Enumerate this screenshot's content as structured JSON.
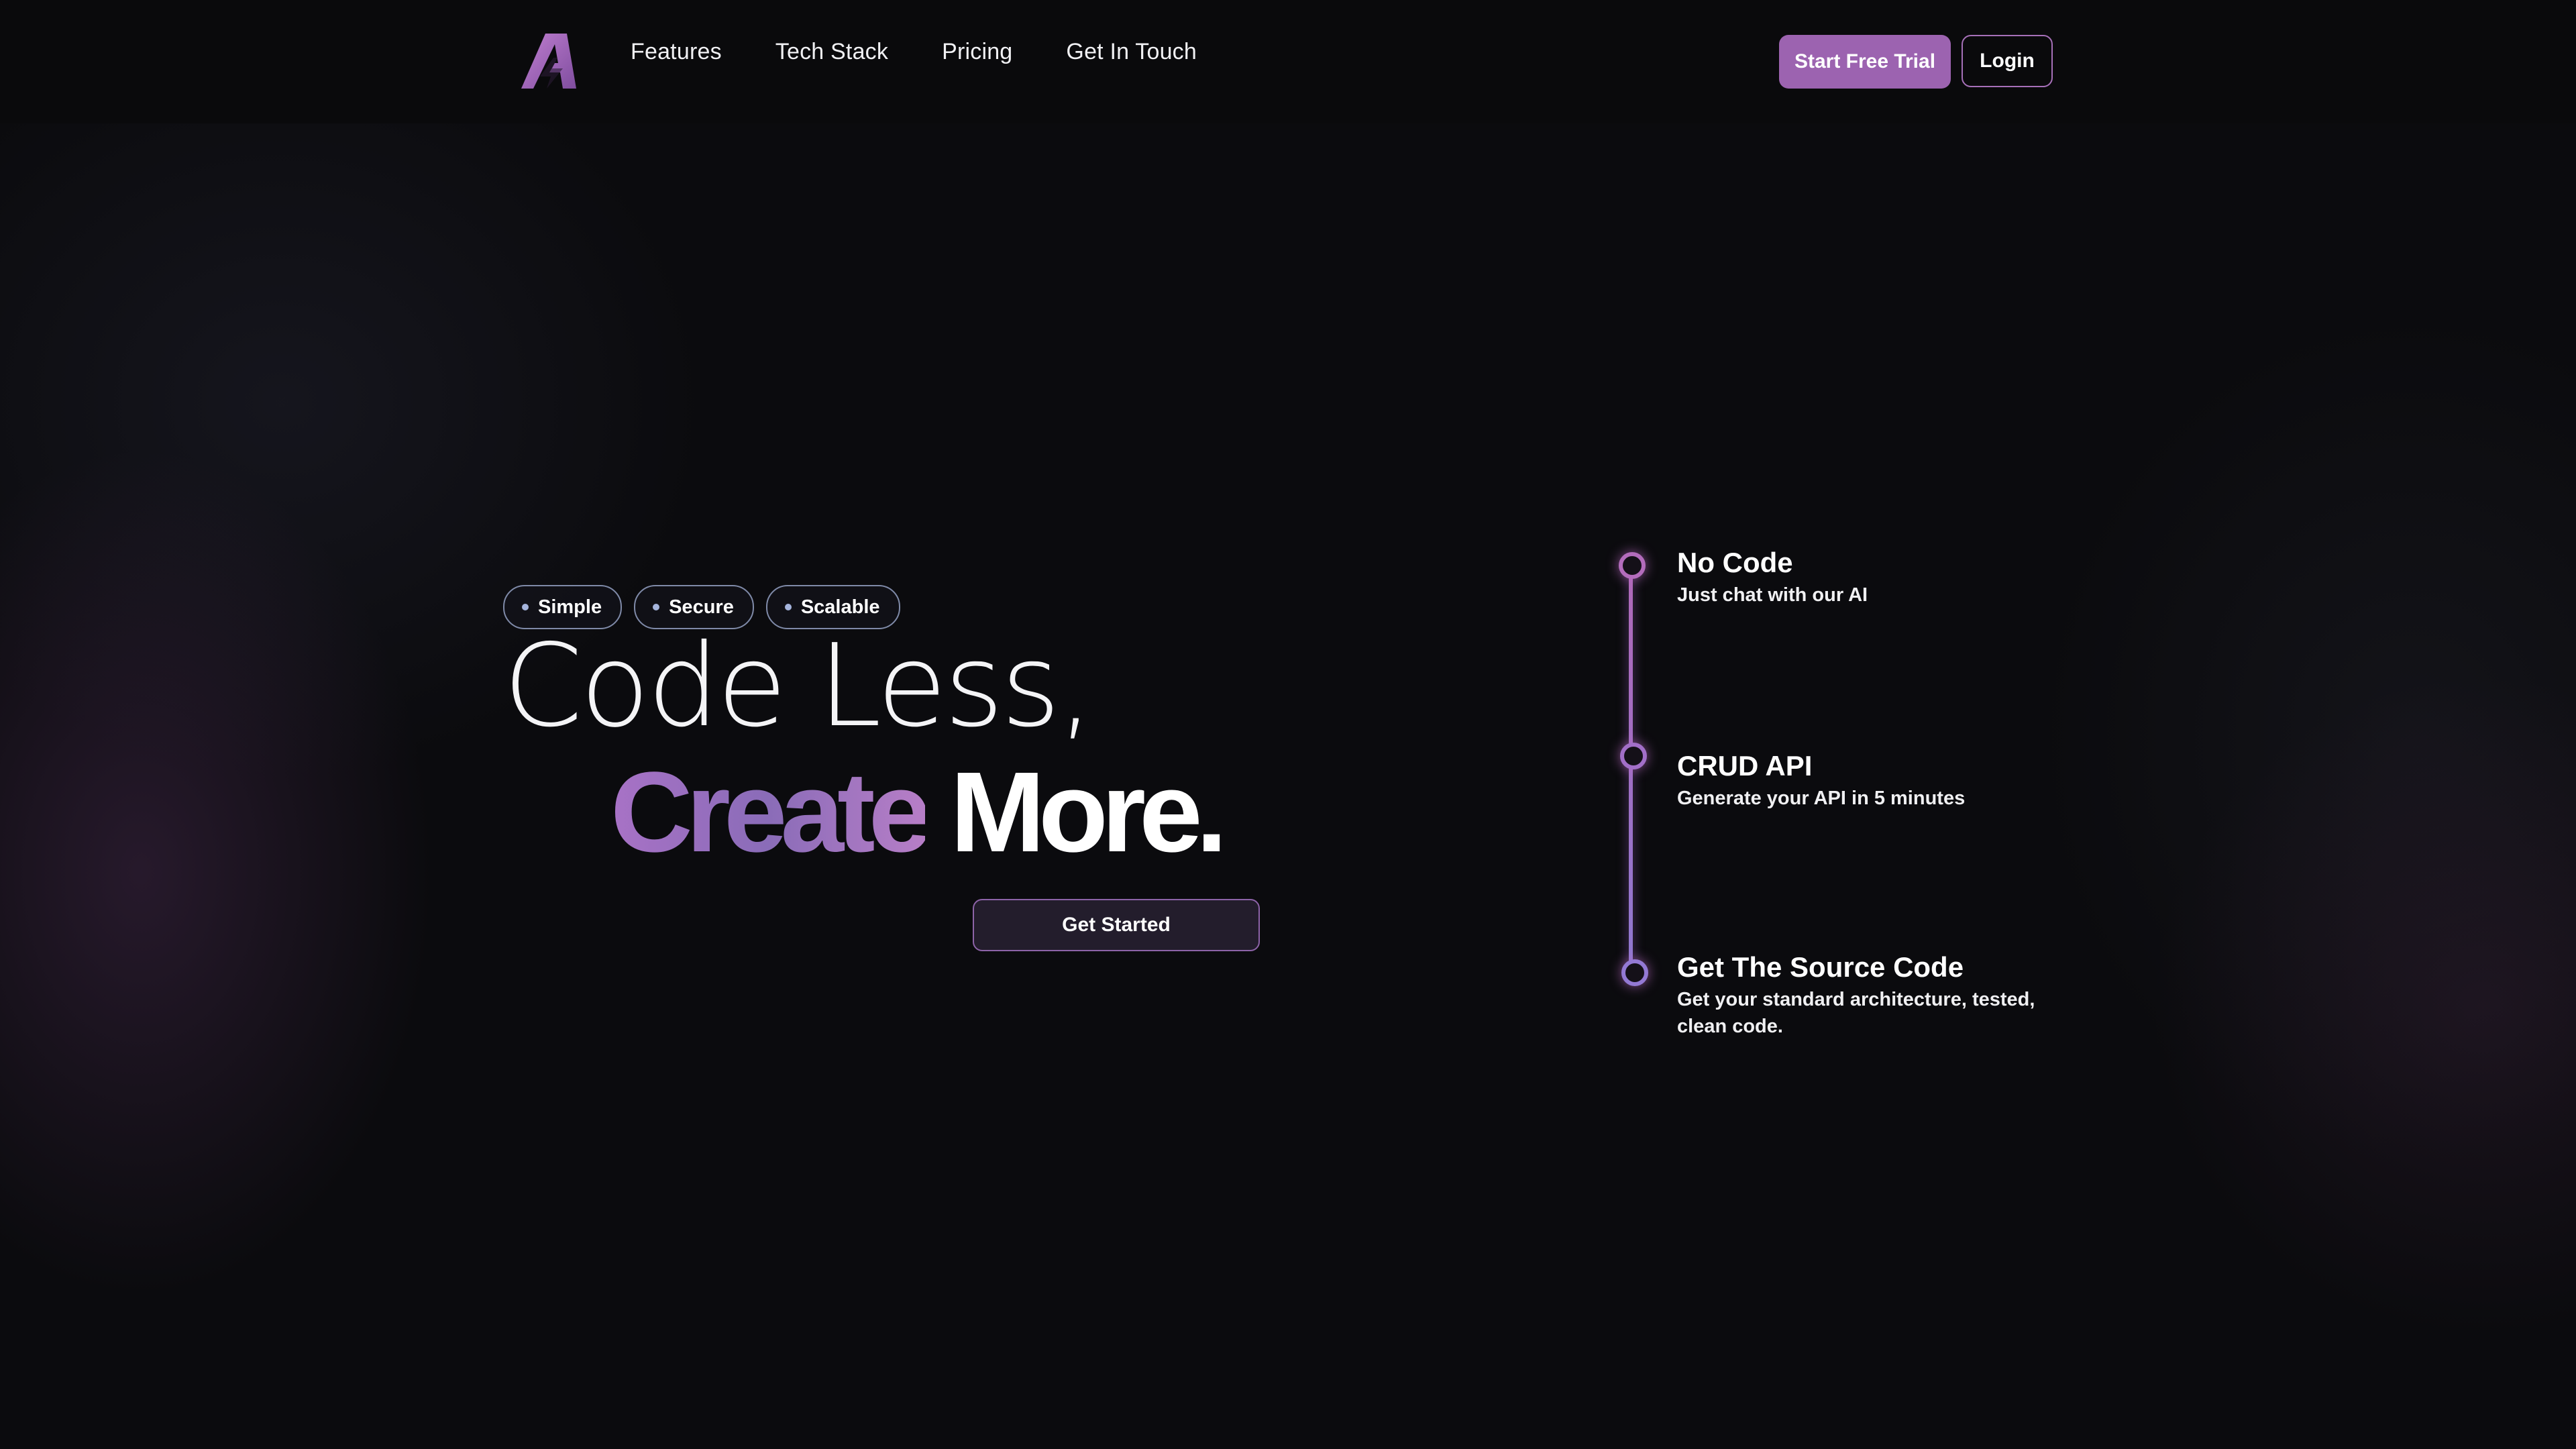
{
  "nav": {
    "logo_icon": "bolt-a-logo",
    "links": [
      "Features",
      "Tech Stack",
      "Pricing",
      "Get In Touch"
    ],
    "trial_label": "Start Free Trial",
    "login_label": "Login"
  },
  "hero": {
    "tags": [
      "Simple",
      "Secure",
      "Scalable"
    ],
    "line1": "Code Less,",
    "line2_accent": "Create",
    "line2_rest": "More.",
    "cta_label": "Get Started"
  },
  "timeline": {
    "steps": [
      {
        "title": "No Code",
        "desc": "Just chat with our AI"
      },
      {
        "title": "CRUD API",
        "desc": "Generate your API in 5 minutes"
      },
      {
        "title": "Get The Source Code",
        "desc": "Get your standard architecture, tested, clean code."
      }
    ]
  },
  "colors": {
    "accent": "#9c63b0",
    "background": "#0b0b0e",
    "pill_border": "#7f8aa8"
  }
}
